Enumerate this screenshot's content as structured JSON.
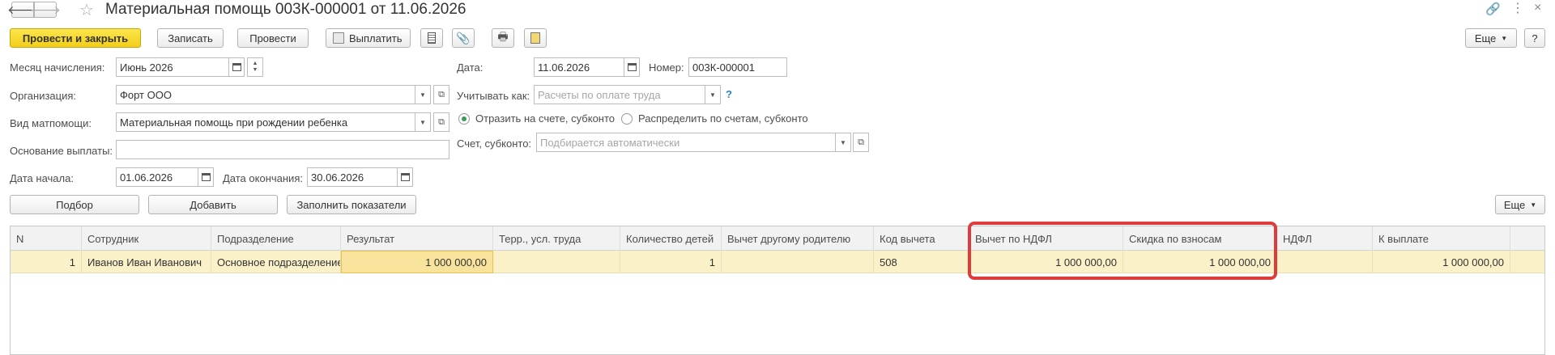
{
  "window": {
    "title": "Материальная помощь 003К-000001 от 11.06.2026",
    "link_icon": "link-icon",
    "more_icon": "kebab-icon",
    "close_icon": "close-icon"
  },
  "toolbar": {
    "post_close": "Провести и закрыть",
    "save": "Записать",
    "post": "Провести",
    "pay": "Выплатить",
    "more": "Еще",
    "help": "?"
  },
  "form": {
    "month_label": "Месяц начисления:",
    "month_value": "Июнь 2026",
    "org_label": "Организация:",
    "org_value": "Форт ООО",
    "type_label": "Вид матпомощи:",
    "type_value": "Материальная помощь при рождении ребенка",
    "basis_label": "Основание выплаты:",
    "basis_value": "",
    "start_label": "Дата начала:",
    "start_value": "01.06.2026",
    "end_label": "Дата окончания:",
    "end_value": "30.06.2026",
    "date_label": "Дата:",
    "date_value": "11.06.2026",
    "number_label": "Номер:",
    "number_value": "003К-000001",
    "account_as_label": "Учитывать как:",
    "account_as_placeholder": "Расчеты по оплате труда",
    "help_q": "?",
    "radio1": "Отразить на счете, субконто",
    "radio2": "Распределить по счетам, субконто",
    "account_label": "Счет, субконто:",
    "account_placeholder": "Подбирается автоматически"
  },
  "table_toolbar": {
    "select": "Подбор",
    "add": "Добавить",
    "fill": "Заполнить показатели",
    "more": "Еще"
  },
  "table": {
    "columns": [
      "N",
      "Сотрудник",
      "Подразделение",
      "Результат",
      "Терр., усл. труда",
      "Количество детей",
      "Вычет другому родителю",
      "Код вычета",
      "Вычет по НДФЛ",
      "Скидка по взносам",
      "НДФЛ",
      "К выплате"
    ],
    "rows": [
      [
        "1",
        "Иванов Иван Иванович",
        "Основное подразделение",
        "1 000 000,00",
        "",
        "1",
        "",
        "508",
        "1 000 000,00",
        "1 000 000,00",
        "",
        "1 000 000,00"
      ]
    ]
  },
  "colors": {
    "primary_button": "#f2ce1c",
    "selected_row": "#fbf1c9",
    "highlight_border": "#e03b3b"
  }
}
